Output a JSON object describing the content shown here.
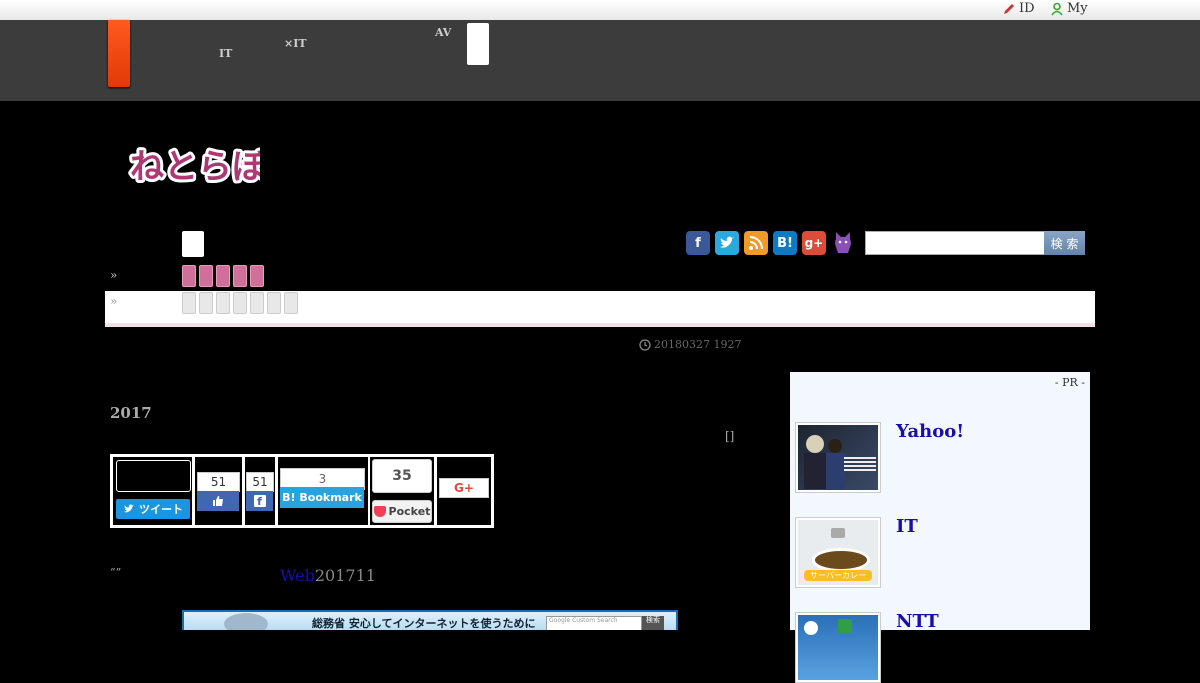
{
  "topbar": {
    "id_link": "ID",
    "my_link": "My"
  },
  "header": {
    "nav_items": [
      {
        "label": "\n\nIT"
      },
      {
        "label": "\n×IT"
      },
      {
        "label": "AV\n"
      }
    ]
  },
  "logo": {
    "text": "ねとらぼ",
    "color": "#b03872"
  },
  "search": {
    "placeholder": "",
    "button_label": "検 索"
  },
  "social_icons": [
    "facebook-icon",
    "twitter-icon",
    "rss-icon",
    "hatena-icon",
    "google-plus-icon",
    "cat-icon"
  ],
  "breadcrumb": {
    "raquo1": "»",
    "raquo2": "»"
  },
  "article": {
    "date": "20180327 1927",
    "headline": "2017",
    "bracket": "[]",
    "quote": "“”",
    "link_text": "Web",
    "text_suffix": "201711"
  },
  "share": {
    "tweet_label": "ツイート",
    "like_count": "51",
    "fb_share_count": "51",
    "hatena_count": "3",
    "hatena_label": "B! Bookmark",
    "pocket_count": "35",
    "pocket_label": "Pocket",
    "gplus_label": "G+"
  },
  "banner": {
    "text": "総務省 安心してインターネットを使うために",
    "search_placeholder": "Google Custom Search",
    "search_button": "検索"
  },
  "sidebar": {
    "pr_label": "- PR -",
    "items": [
      {
        "title": "Yahoo!"
      },
      {
        "title": "IT",
        "thumb_caption": "サーバーカレー"
      },
      {
        "title": "NTT"
      }
    ]
  },
  "colors": {
    "accent_orange": "#ff5a1f",
    "pink_tab": "#d0709a",
    "link_blue": "#1a0dab",
    "sidebar_bg": "#f2f8fd"
  }
}
